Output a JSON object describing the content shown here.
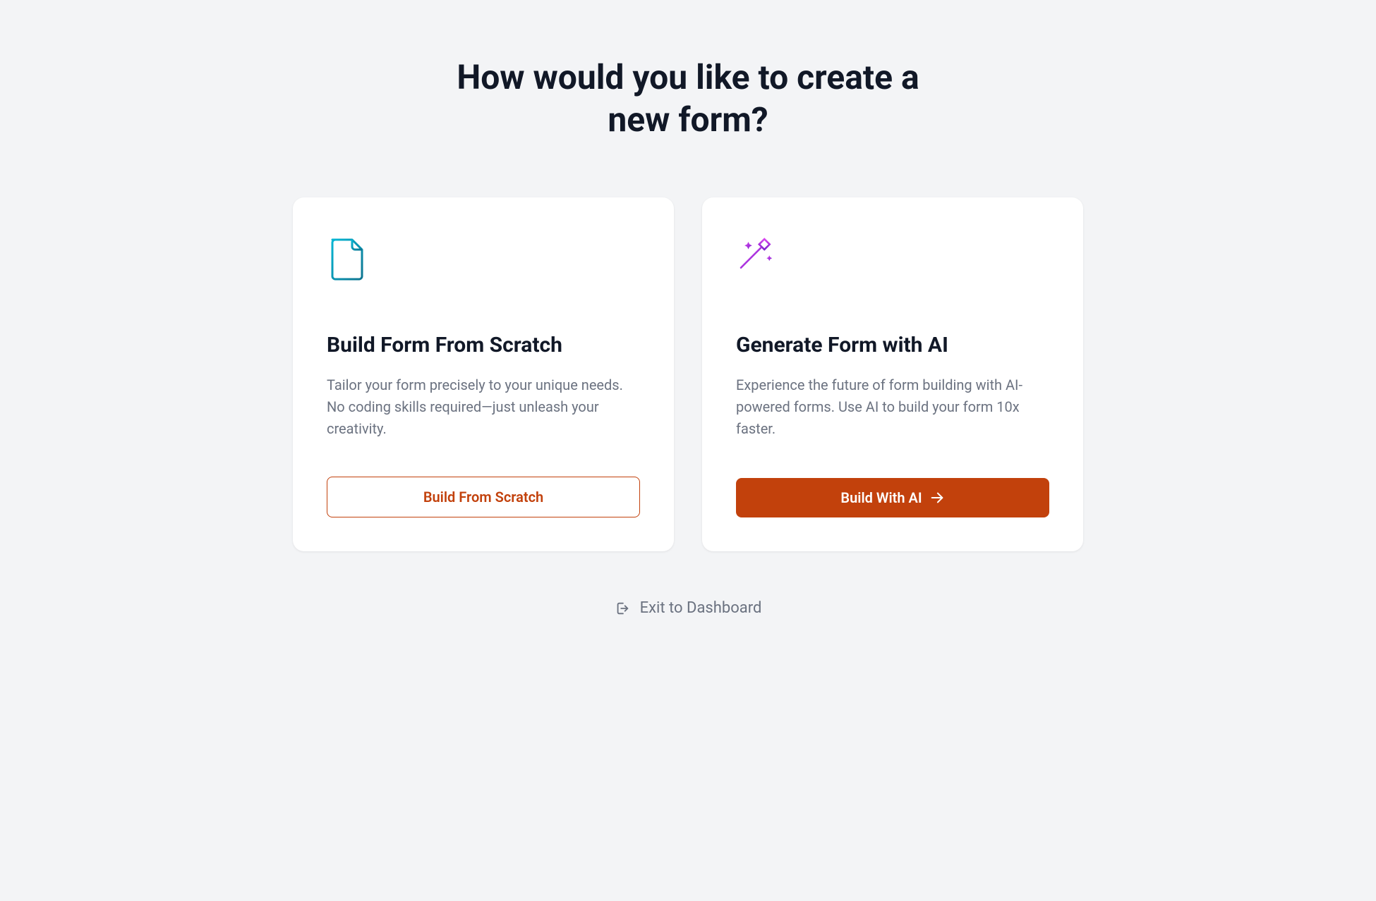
{
  "header": {
    "title": "How would you like to create a new form?"
  },
  "cards": {
    "scratch": {
      "title": "Build Form From Scratch",
      "description": "Tailor your form precisely to your unique needs. No coding skills required—just unleash your creativity.",
      "button_label": "Build From Scratch"
    },
    "ai": {
      "title": "Generate Form with AI",
      "description": "Experience the future of form building with AI-powered forms. Use AI to build your form 10x faster.",
      "button_label": "Build With AI"
    }
  },
  "footer": {
    "exit_label": "Exit to Dashboard"
  },
  "colors": {
    "accent": "#c2410c",
    "gradient_scratch_start": "#06b6d4",
    "gradient_scratch_end": "#0e7490",
    "gradient_ai_start": "#d946ef",
    "gradient_ai_end": "#7e22ce"
  }
}
